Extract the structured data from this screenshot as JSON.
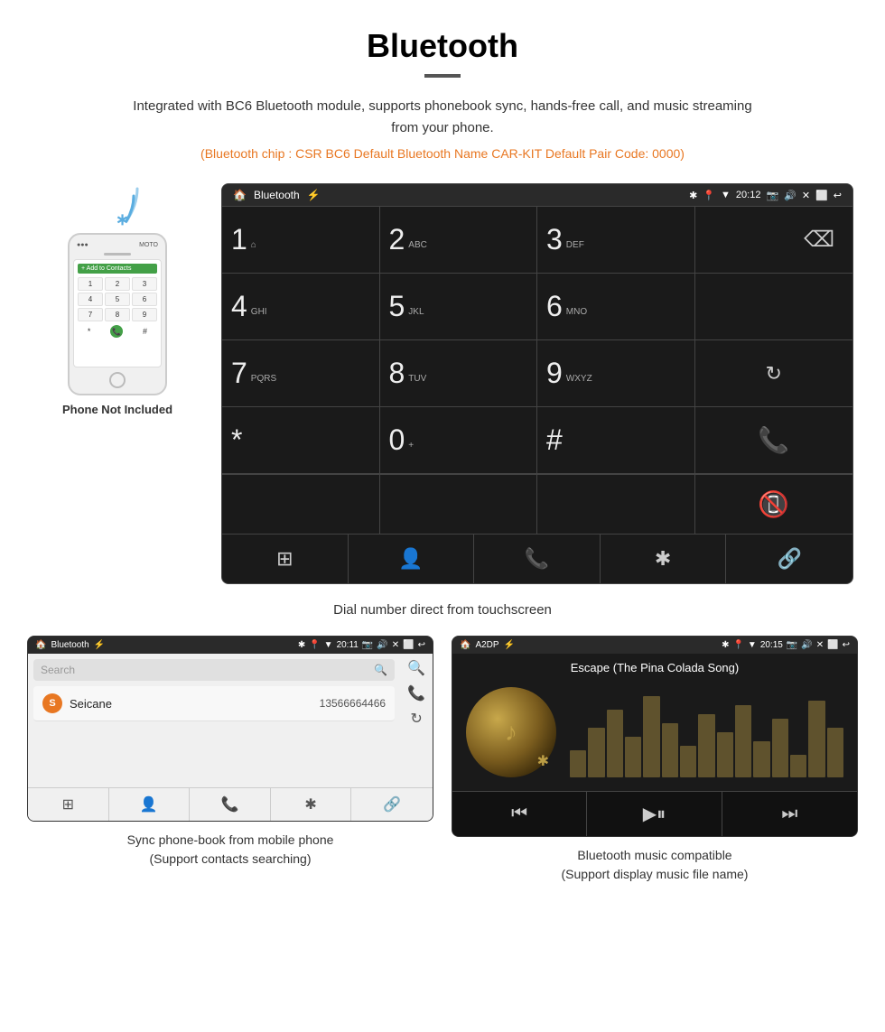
{
  "page": {
    "title": "Bluetooth",
    "subtitle": "Integrated with BC6 Bluetooth module, supports phonebook sync, hands-free call, and music streaming from your phone.",
    "bluetooth_info": "(Bluetooth chip : CSR BC6    Default Bluetooth Name CAR-KIT    Default Pair Code: 0000)",
    "dial_caption": "Dial number direct from touchscreen"
  },
  "phone": {
    "not_included_text": "Phone Not Included"
  },
  "bt_dial": {
    "title": "Bluetooth",
    "time": "20:12",
    "keys": [
      {
        "num": "1",
        "sub": ""
      },
      {
        "num": "2",
        "sub": "ABC"
      },
      {
        "num": "3",
        "sub": "DEF"
      },
      {
        "num": "4",
        "sub": "GHI"
      },
      {
        "num": "5",
        "sub": "JKL"
      },
      {
        "num": "6",
        "sub": "MNO"
      },
      {
        "num": "7",
        "sub": "PQRS"
      },
      {
        "num": "8",
        "sub": "TUV"
      },
      {
        "num": "9",
        "sub": "WXYZ"
      },
      {
        "num": "*",
        "sub": ""
      },
      {
        "num": "0",
        "sub": "+"
      },
      {
        "num": "#",
        "sub": ""
      }
    ],
    "bottom_icons": [
      "⊞",
      "👤",
      "📞",
      "✱",
      "🔗"
    ]
  },
  "phonebook": {
    "title": "Bluetooth",
    "time": "20:11",
    "search_placeholder": "Search",
    "contact": {
      "initial": "S",
      "name": "Seicane",
      "phone": "13566664466"
    },
    "caption_line1": "Sync phone-book from mobile phone",
    "caption_line2": "(Support contacts searching)"
  },
  "music": {
    "title": "A2DP",
    "time": "20:15",
    "song_title": "Escape (The Pina Colada Song)",
    "caption_line1": "Bluetooth music compatible",
    "caption_line2": "(Support display music file name)"
  },
  "colors": {
    "orange": "#e87722",
    "green": "#4caf50",
    "red": "#f44336",
    "dark_bg": "#1a1a1a",
    "status_bar": "#2a2a2a"
  }
}
